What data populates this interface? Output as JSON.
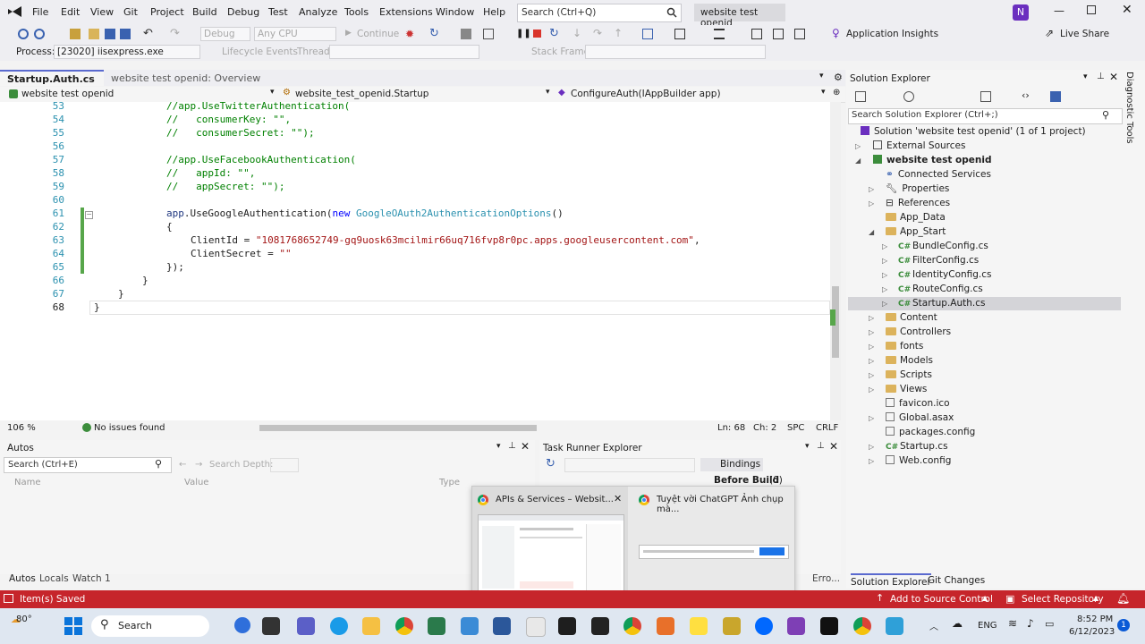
{
  "menu": {
    "items": [
      "File",
      "Edit",
      "View",
      "Git",
      "Project",
      "Build",
      "Debug",
      "Test",
      "Analyze",
      "Tools",
      "Extensions",
      "Window",
      "Help"
    ],
    "search_placeholder": "Search (Ctrl+Q)",
    "solution_name": "website test openid",
    "user_initial": "N"
  },
  "toolbar": {
    "config": "Debug",
    "platform": "Any CPU",
    "continue": "Continue",
    "app_insights": "Application Insights",
    "live_share": "Live Share",
    "process_label": "Process:",
    "process_value": "[23020] iisexpress.exe",
    "lifecycle": "Lifecycle Events",
    "thread": "Thread:",
    "stack_frame": "Stack Frame:"
  },
  "editor": {
    "tab_active": "Startup.Auth.cs",
    "tab_other": "website test openid: Overview",
    "nav_project": "website test openid",
    "nav_class": "website_test_openid.Startup",
    "nav_member": "ConfigureAuth(IAppBuilder app)",
    "lines": [
      {
        "n": "53",
        "t": "            //app.UseTwitterAuthentication("
      },
      {
        "n": "54",
        "t": "            //   consumerKey: \"\","
      },
      {
        "n": "55",
        "t": "            //   consumerSecret: \"\");"
      },
      {
        "n": "56",
        "t": ""
      },
      {
        "n": "57",
        "t": "            //app.UseFacebookAuthentication("
      },
      {
        "n": "58",
        "t": "            //   appId: \"\","
      },
      {
        "n": "59",
        "t": "            //   appSecret: \"\");"
      },
      {
        "n": "60",
        "t": ""
      },
      {
        "n": "61",
        "t": "            app.UseGoogleAuthentication(new GoogleOAuth2AuthenticationOptions()"
      },
      {
        "n": "62",
        "t": "            {"
      },
      {
        "n": "63",
        "t": "                ClientId = \"1081768652749-gq9uosk63mcilmir66uq716fvp8r0pc.apps.googleusercontent.com\","
      },
      {
        "n": "64",
        "t": "                ClientSecret = \"\""
      },
      {
        "n": "65",
        "t": "            });"
      },
      {
        "n": "66",
        "t": "        }"
      },
      {
        "n": "67",
        "t": "    }"
      },
      {
        "n": "68",
        "t": "}"
      }
    ],
    "code": {
      "l53": "//app.UseTwitterAuthentication(",
      "l54": "//   consumerKey: \"\",",
      "l55": "//   consumerSecret: \"\");",
      "l57": "//app.UseFacebookAuthentication(",
      "l58": "//   appId: \"\",",
      "l59": "//   appSecret: \"\");",
      "l61a": "app",
      "l61b": ".UseGoogleAuthentication(",
      "l61c": "new",
      "l61d": "GoogleOAuth2AuthenticationOptions",
      "l61e": "()",
      "l62": "{",
      "l63a": "ClientId = ",
      "l63b": "\"1081768652749-gq9uosk63mcilmir66uq716fvp8r0pc.apps.googleusercontent.com\"",
      "l63c": ",",
      "l64a": "ClientSecret = ",
      "l64b": "\"\"",
      "l65": "});",
      "l66": "}",
      "l67": "}",
      "l68": "}"
    },
    "zoom": "106 %",
    "issues": "No issues found",
    "ln": "Ln: 68",
    "ch": "Ch: 2",
    "spc": "SPC",
    "crlf": "CRLF"
  },
  "solution_explorer": {
    "title": "Solution Explorer",
    "search_placeholder": "Search Solution Explorer (Ctrl+;)",
    "items": [
      {
        "label": "Solution 'website test openid' (1 of 1 project)",
        "indent": 0
      },
      {
        "label": "External Sources",
        "indent": 1
      },
      {
        "label": "website test openid",
        "indent": 1,
        "bold": true
      },
      {
        "label": "Connected Services",
        "indent": 2
      },
      {
        "label": "Properties",
        "indent": 2
      },
      {
        "label": "References",
        "indent": 2
      },
      {
        "label": "App_Data",
        "indent": 2
      },
      {
        "label": "App_Start",
        "indent": 2
      },
      {
        "label": "BundleConfig.cs",
        "indent": 3
      },
      {
        "label": "FilterConfig.cs",
        "indent": 3
      },
      {
        "label": "IdentityConfig.cs",
        "indent": 3
      },
      {
        "label": "RouteConfig.cs",
        "indent": 3
      },
      {
        "label": "Startup.Auth.cs",
        "indent": 3,
        "selected": true
      },
      {
        "label": "Content",
        "indent": 2
      },
      {
        "label": "Controllers",
        "indent": 2
      },
      {
        "label": "fonts",
        "indent": 2
      },
      {
        "label": "Models",
        "indent": 2
      },
      {
        "label": "Scripts",
        "indent": 2
      },
      {
        "label": "Views",
        "indent": 2
      },
      {
        "label": "favicon.ico",
        "indent": 2
      },
      {
        "label": "Global.asax",
        "indent": 2
      },
      {
        "label": "packages.config",
        "indent": 2
      },
      {
        "label": "Startup.cs",
        "indent": 2
      },
      {
        "label": "Web.config",
        "indent": 2
      }
    ],
    "tab_solution": "Solution Explorer",
    "tab_git": "Git Changes",
    "side_tab": "Diagnostic Tools"
  },
  "autos": {
    "title": "Autos",
    "search_placeholder": "Search (Ctrl+E)",
    "search_depth": "Search Depth:",
    "col_name": "Name",
    "col_value": "Value",
    "col_type": "Type",
    "tabs": [
      "Autos",
      "Locals",
      "Watch 1"
    ]
  },
  "task_runner": {
    "title": "Task Runner Explorer",
    "bindings": "Bindings",
    "before_build": "Before Build",
    "before_build_count": "(0)",
    "errors_tab": "Erro..."
  },
  "popup": {
    "item1": "APIs & Services – Websit...",
    "item2": "Tuyệt vời ChatGPT Ảnh chụp mà..."
  },
  "statusbar": {
    "saved": "Item(s) Saved",
    "source_control": "Add to Source Control",
    "repository": "Select Repository"
  },
  "taskbar": {
    "weather": "80°",
    "search": "Search",
    "lang": "ENG",
    "time": "8:52 PM",
    "date": "6/12/2023",
    "notif": "1"
  },
  "colors": {
    "status_red": "#c6252b",
    "accent": "#5a6acf"
  }
}
